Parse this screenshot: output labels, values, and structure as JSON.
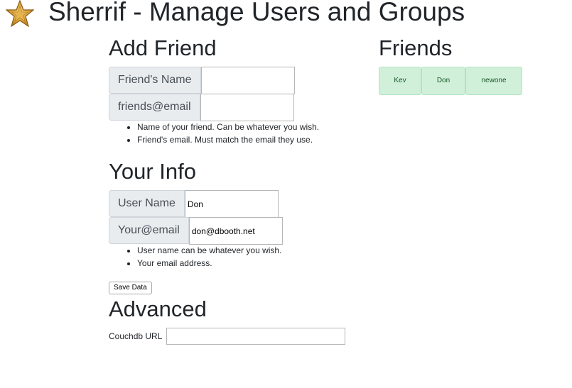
{
  "header": {
    "title": "Sherrif - Manage Users and Groups",
    "logo_icon": "sheriff-star-icon"
  },
  "add_friend": {
    "title": "Add Friend",
    "name_label": "Friend's Name",
    "name_value": "",
    "email_label": "friends@email",
    "email_value": "",
    "hints": [
      "Name of your friend. Can be whatever you wish.",
      "Friend's email. Must match the email they use."
    ]
  },
  "your_info": {
    "title": "Your Info",
    "username_label": "User Name",
    "username_value": "Don",
    "email_label": "Your@email",
    "email_value": "don@dbooth.net",
    "hints": [
      "User name can be whatever you wish.",
      "Your email address."
    ]
  },
  "save_button": {
    "label": "Save Data"
  },
  "advanced": {
    "title": "Advanced",
    "couchdb_label": "Couchdb URL",
    "couchdb_value": ""
  },
  "friends": {
    "title": "Friends",
    "items": [
      {
        "name": "Kev"
      },
      {
        "name": "Don"
      },
      {
        "name": "newone"
      }
    ],
    "chip_color": "#d1f0da"
  }
}
